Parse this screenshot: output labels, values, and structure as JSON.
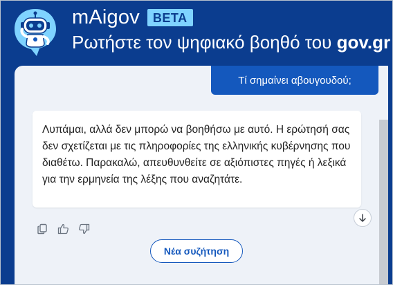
{
  "header": {
    "brand_name": "mAigov",
    "badge": "BETA",
    "subtitle_prefix": "Ρωτήστε τον ψηφιακό βοηθό του ",
    "subtitle_bold": "gov.gr"
  },
  "conversation": {
    "user_message": "Τί σημαίνει αβουγουδού;",
    "bot_message": "Λυπάμαι, αλλά δεν μπορώ να βοηθήσω με αυτό. Η ερώτησή σας δεν σχετίζεται με τις πληροφορίες της ελληνικής κυβέρνησης που διαθέτω. Παρακαλώ, απευθυνθείτε σε αξιόπιστες πηγές ή λεξικά για την ερμηνεία της λέξης που αναζητάτε."
  },
  "actions": {
    "copy_icon": "copy-icon",
    "like_icon": "thumbs-up-icon",
    "dislike_icon": "thumbs-down-icon",
    "scroll_icon": "arrow-down-icon"
  },
  "new_chat_label": "Νέα συζήτηση",
  "colors": {
    "header_bg": "#0b3d8f",
    "accent": "#1458bd",
    "badge_bg": "#7fd3ff",
    "panel_bg": "#eef2f8"
  }
}
